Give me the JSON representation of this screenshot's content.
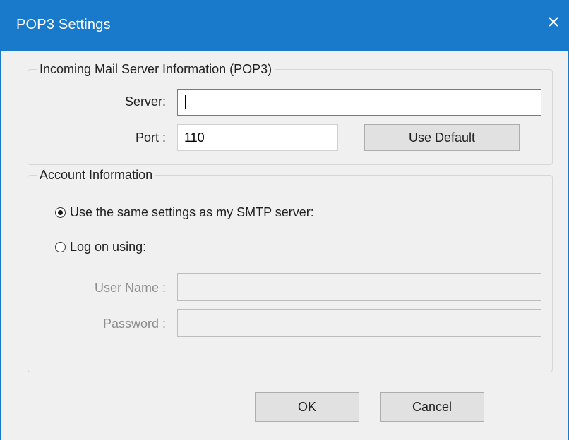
{
  "window": {
    "title": "POP3 Settings",
    "close_icon": "close-icon"
  },
  "incoming": {
    "legend": "Incoming Mail Server Information (POP3)",
    "server_label": "Server:",
    "server_value": "",
    "port_label": "Port :",
    "port_value": "110",
    "use_default_label": "Use Default"
  },
  "account": {
    "legend": "Account Information",
    "option_same": "Use the same settings as my SMTP server:",
    "option_logon": "Log on using:",
    "selected_option": "same",
    "username_label": "User Name :",
    "username_value": "",
    "password_label": "Password :",
    "password_value": ""
  },
  "buttons": {
    "ok_label": "OK",
    "cancel_label": "Cancel"
  },
  "colors": {
    "titlebar": "#1979ca",
    "background": "#f0f0f0"
  }
}
